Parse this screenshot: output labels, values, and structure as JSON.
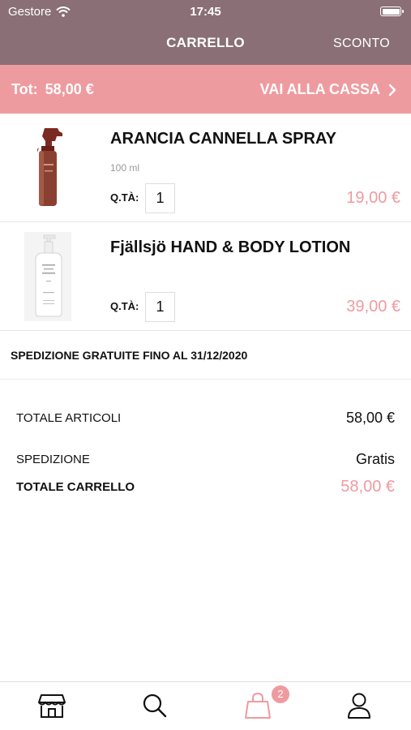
{
  "status_bar": {
    "carrier": "Gestore",
    "time": "17:45"
  },
  "nav": {
    "title": "CARRELLO",
    "discount_label": "SCONTO"
  },
  "checkout": {
    "total_label": "Tot:",
    "total_value": "58,00 €",
    "go_label": "VAI ALLA CASSA"
  },
  "cart": {
    "qty_label": "Q.TÀ:",
    "items": [
      {
        "name": "ARANCIA CANNELLA SPRAY",
        "size": "100 ml",
        "qty": "1",
        "price": "19,00 €"
      },
      {
        "name": "Fjällsjö HAND & BODY LOTION",
        "size": "",
        "qty": "1",
        "price": "39,00 €"
      }
    ]
  },
  "shipping_note": "SPEDIZIONE GRATUITE FINO AL 31/12/2020",
  "summary": {
    "items_total_label": "TOTALE ARTICOLI",
    "items_total_value": "58,00 €",
    "shipping_label": "SPEDIZIONE",
    "shipping_value": "Gratis",
    "cart_total_label": "TOTALE CARRELLO",
    "cart_total_value": "58,00 €"
  },
  "tab_bar": {
    "tabs": [
      {
        "icon": "store-icon"
      },
      {
        "icon": "search-icon"
      },
      {
        "icon": "shopping-bag-icon"
      },
      {
        "icon": "user-icon"
      }
    ],
    "cart_badge": "2"
  },
  "colors": {
    "header": "#8a6f76",
    "accent": "#ee9ba0"
  }
}
